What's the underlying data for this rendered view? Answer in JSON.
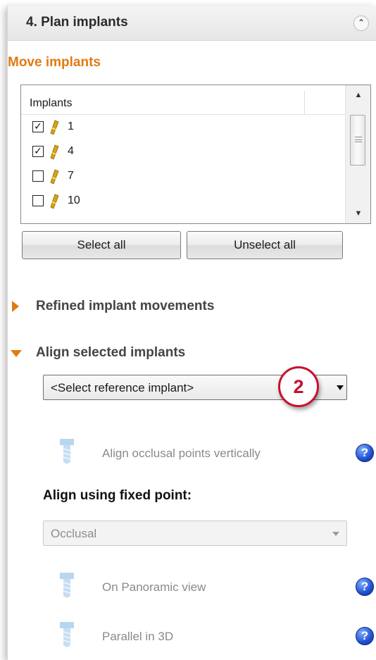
{
  "header": {
    "title": "4. Plan implants",
    "collapse_icon": "double-chevron-up-icon"
  },
  "section": {
    "title": "Move implants"
  },
  "implants_list": {
    "column_header": "Implants",
    "rows": [
      {
        "label": "1",
        "checked": true
      },
      {
        "label": "4",
        "checked": true
      },
      {
        "label": "7",
        "checked": false
      },
      {
        "label": "10",
        "checked": false
      }
    ]
  },
  "buttons": {
    "select_all": "Select all",
    "unselect_all": "Unselect all"
  },
  "refined": {
    "label": "Refined implant movements",
    "expanded": false
  },
  "align": {
    "label": "Align selected implants",
    "expanded": true,
    "reference_combo": "<Select reference implant>",
    "callout_number": "2",
    "occlusal_label": "Align occlusal points vertically",
    "fixed_point_heading": "Align using fixed point:",
    "fixed_point_combo": "Occlusal",
    "panoramic_label": "On Panoramic view",
    "parallel_label": "Parallel in 3D"
  },
  "colors": {
    "accent": "#e07b12",
    "callout": "#c8102e",
    "help": "#1f4fd0"
  }
}
